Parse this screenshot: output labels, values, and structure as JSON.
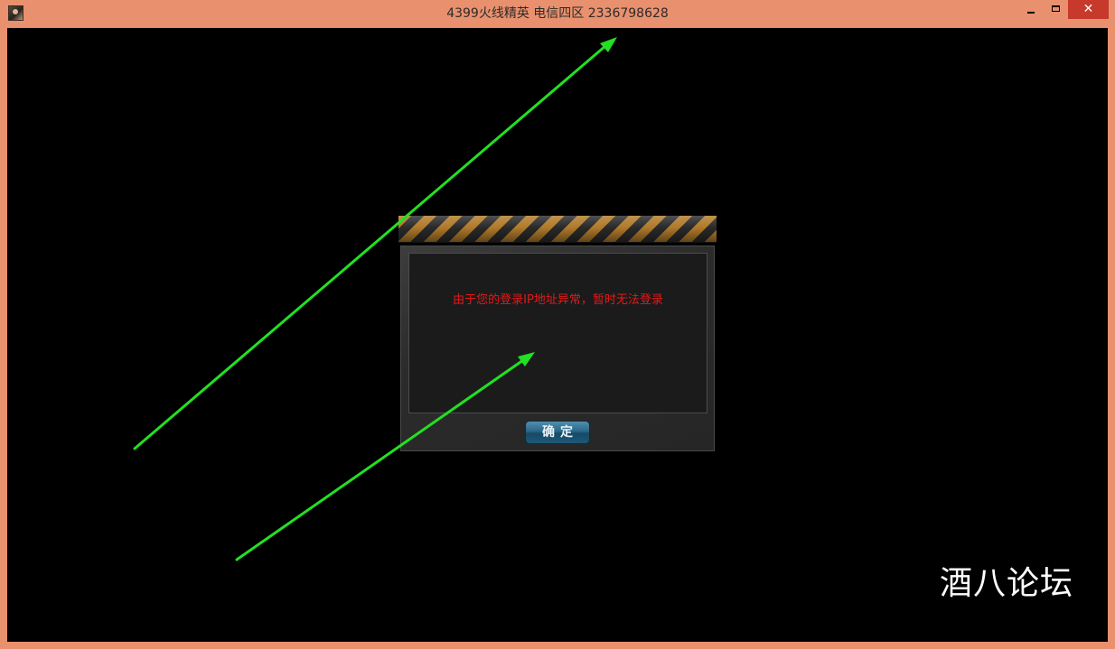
{
  "window": {
    "title": "4399火线精英 电信四区 2336798628",
    "icon": "app-icon",
    "controls": {
      "minimize": "minimize-icon",
      "maximize": "maximize-icon",
      "close_label": "✕"
    },
    "frame_color": "#e9906e"
  },
  "dialog": {
    "message": "由于您的登录IP地址异常，暂时无法登录",
    "confirm_label": "确定",
    "message_color": "#e01a1a"
  },
  "watermark": {
    "text": "酒八论坛"
  },
  "annotations": {
    "arrow_color": "#22e022"
  }
}
